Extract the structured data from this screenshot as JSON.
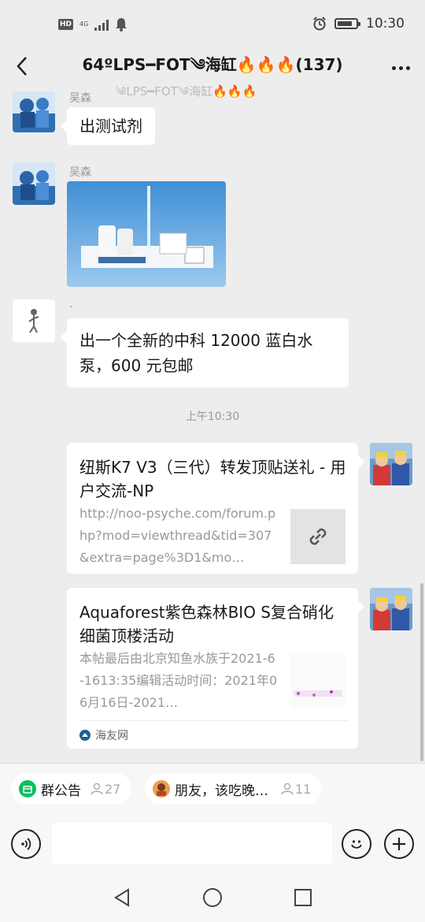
{
  "status_bar": {
    "hd": "HD",
    "network": "4G",
    "time": "10:30"
  },
  "header": {
    "title": "64ºLPS━FOT༄海缸🔥🔥🔥(137)",
    "ghost_title": "༄LPS━FOT༄海缸🔥🔥🔥"
  },
  "messages": [
    {
      "sender": "吴森",
      "text": "出测试剂"
    },
    {
      "sender": "吴森",
      "image": "test-kit-photo"
    },
    {
      "sender": "·",
      "text": "出一个全新的中科 12000 蓝白水泵，600 元包邮"
    }
  ],
  "timestamp": "上午10:30",
  "link_cards": [
    {
      "title": "纽斯K7 V3（三代）转发顶贴送礼 - 用户交流-NP",
      "desc": "http://noo-psyche.com/forum.php?mod=viewthread&tid=307&extra=page%3D1&mo…",
      "thumb": "link-icon"
    },
    {
      "title": "Aquaforest紫色森林BIO S复合硝化细菌顶楼活动",
      "desc": "本帖最后由北京知鱼水族于2021-6-1613:35编辑活动时间：2021年06月16日-2021…",
      "source": "海友网"
    }
  ],
  "pills": [
    {
      "label": "群公告",
      "count": "27"
    },
    {
      "label": "朋友，该吃晚…",
      "count": "11"
    }
  ],
  "input": {
    "placeholder": ""
  },
  "colors": {
    "bubble": "#ffffff",
    "background": "#ededed",
    "accent_green": "#07c160"
  }
}
